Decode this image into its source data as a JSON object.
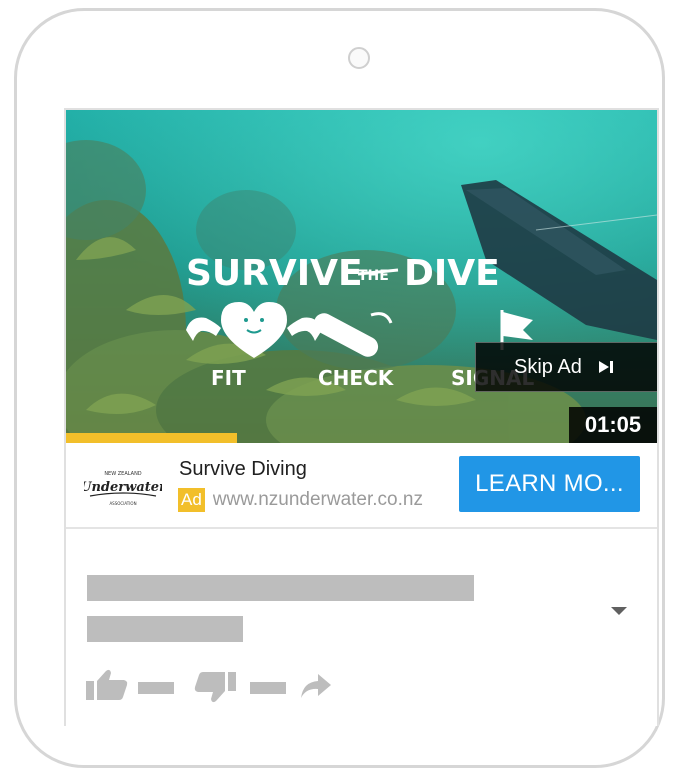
{
  "video": {
    "headline": "SURVIVE",
    "headline_mid": "THE",
    "headline_end": "DIVE",
    "icon_labels": [
      "FIT",
      "CHECK",
      "SIGNAL"
    ],
    "skip_label": "Skip Ad",
    "timer": "01:05",
    "progress": 0.29
  },
  "ad": {
    "advertiser": "Survive Diving",
    "badge": "Ad",
    "url": "www.nzunderwater.co.nz",
    "cta_label": "LEARN MO...",
    "logo_text_top": "NEW ZEALAND",
    "logo_text_main": "Underwater",
    "logo_text_bottom": "ASSOCIATION"
  },
  "colors": {
    "accent_yellow": "#f2bf2a",
    "cta_blue": "#2196e6",
    "placeholder_gray": "#bdbdbd"
  },
  "icons": [
    "thumbs-up-icon",
    "thumbs-down-icon",
    "share-icon",
    "chevron-down-icon",
    "skip-next-icon"
  ]
}
